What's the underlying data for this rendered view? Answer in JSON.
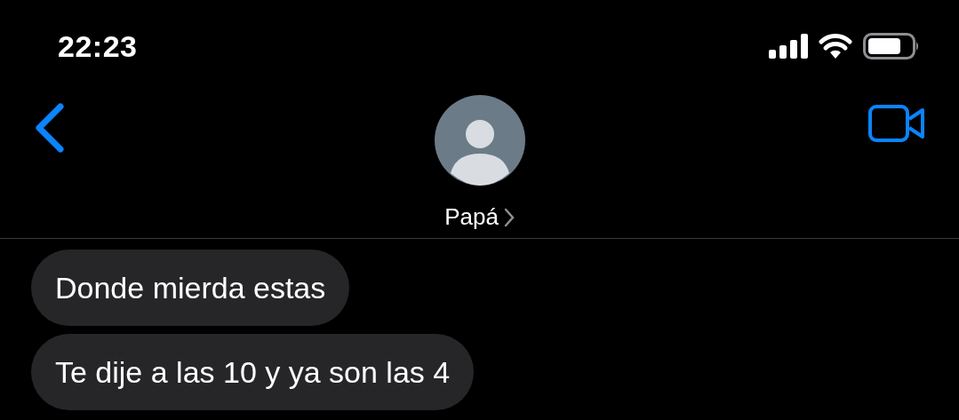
{
  "status_bar": {
    "time": "22:23"
  },
  "contact": {
    "name": "Papá"
  },
  "messages": [
    {
      "kind": "incoming",
      "text": "Donde mierda estas"
    },
    {
      "kind": "incoming",
      "text": "Te dije a las 10 y ya son las 4"
    }
  ]
}
